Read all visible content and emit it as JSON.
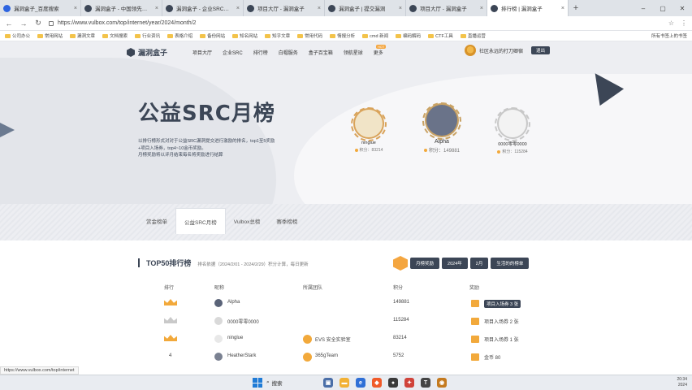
{
  "browser": {
    "tabs": [
      {
        "title": "漏洞盒子_百度搜索",
        "color": "#2d64e0",
        "active": false
      },
      {
        "title": "漏洞盒子 - 中国领先的漏洞平台",
        "color": "#3c4656",
        "active": false
      },
      {
        "title": "漏洞盒子 - 企业SRC，快速为...",
        "color": "#3c4656",
        "active": false
      },
      {
        "title": "项目大厅 - 漏洞盒子",
        "color": "#3c4656",
        "active": false
      },
      {
        "title": "漏洞盒子 | 提交漏洞",
        "color": "#3c4656",
        "active": false
      },
      {
        "title": "项目大厅 - 漏洞盒子",
        "color": "#3c4656",
        "active": false
      },
      {
        "title": "排行榜 | 漏洞盒子",
        "color": "#3c4656",
        "active": true
      }
    ],
    "new_tab": "+",
    "window_controls": [
      "–",
      "▢",
      "✕"
    ],
    "url": "https://www.vulbox.com/top/internet/year/2024/month/2",
    "bookmarks": [
      "公司办公",
      "常用网站",
      "漏洞文章",
      "文档搜索",
      "行业资讯",
      "表格介绍",
      "备份网站",
      "知名网站",
      "知乎文章",
      "常用代码",
      "情报分析",
      "cmd 新闻",
      "编码解码",
      "CTF工具",
      "直播运营"
    ],
    "bookmarks_right": "所有书签上的书签",
    "status_url": "https://www.vulbox.com/top/internet"
  },
  "site": {
    "logo": "漏洞盒子",
    "nav": [
      "项目大厅",
      "企业SRC",
      "排行榜",
      "白帽服务",
      "盒子百宝箱",
      "领航星球",
      "更多"
    ],
    "nav_hot": "HOT",
    "user_name": "社区永远的打刀卿宿",
    "user_button": "退出"
  },
  "hero": {
    "title": "公益SRC月榜",
    "desc": [
      "以排行榜形式对对于公益SRC漏洞提交进行激励的排名，top1至5奖励",
      "+项目入场券，top4~10金币奖励。",
      "月榜奖励将以评月结束每名将奖励进行结算"
    ]
  },
  "podium": [
    {
      "name": "ninglue",
      "score": "积分：83214",
      "ring": "#d9a35a",
      "fill": "#f1e4c7"
    },
    {
      "name": "Alpha",
      "score": "积分：149881",
      "ring": "#c9a264",
      "fill": "#6a7389"
    },
    {
      "name": "0000零零0000",
      "score": "积分：115284",
      "ring": "#c8c8c8",
      "fill": "#f3f3f3"
    }
  ],
  "subtabs": [
    "赏金榜单",
    "公益SRC月榜",
    "Vulbox总榜",
    "赛季榜榜"
  ],
  "list": {
    "title": "TOP50排行榜",
    "note": "排名依据（2024/2/01 - 2024/2/29）积分计算，每日更新",
    "filters": [
      "月榜奖励",
      "2024年",
      "2月",
      "生活的的榜单"
    ],
    "headers": {
      "rank": "排行",
      "name": "昵称",
      "team": "所属团队",
      "score": "积分",
      "reward": "奖励"
    },
    "rows": [
      {
        "rank_medal": "gold",
        "name": "Alpha",
        "team": "",
        "score": "149881",
        "reward": "项目入场券 3 张",
        "reward_chip": true
      },
      {
        "rank_medal": "silver",
        "name": "0000零零0000",
        "team": "",
        "score": "115284",
        "reward": "项目入场券 2 张",
        "reward_chip": false
      },
      {
        "rank_medal": "bronze",
        "name": "ninglue",
        "team": "EVS 安全实验室",
        "score": "83214",
        "reward": "项目入场券 1 张",
        "reward_chip": false
      },
      {
        "rank_medal": "4",
        "name": "HeatherStark",
        "team": "365gTeam",
        "score": "5752",
        "reward": "金币 80",
        "reward_chip": false
      }
    ]
  },
  "taskbar": {
    "search": "搜索",
    "time": "20:34",
    "date": "2024"
  }
}
